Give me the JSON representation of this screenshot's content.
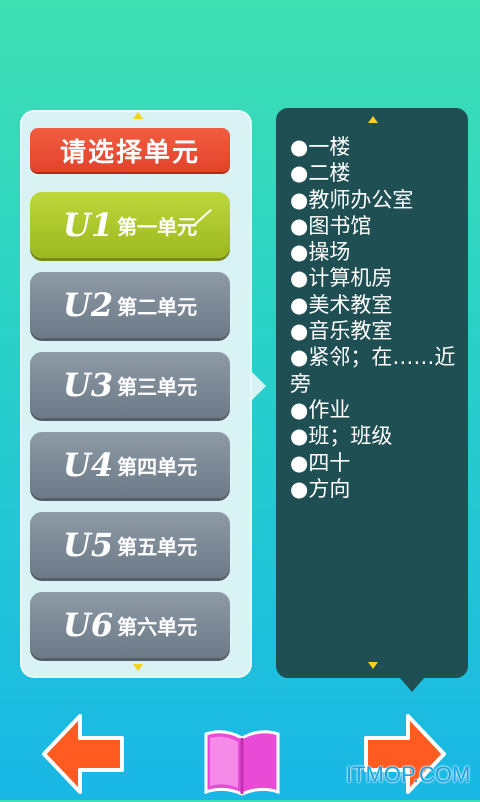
{
  "left_panel": {
    "header_label": "请选择单元",
    "units": [
      {
        "code": "U1",
        "name": "第一单元",
        "active": true
      },
      {
        "code": "U2",
        "name": "第二单元",
        "active": false
      },
      {
        "code": "U3",
        "name": "第三单元",
        "active": false
      },
      {
        "code": "U4",
        "name": "第四单元",
        "active": false
      },
      {
        "code": "U5",
        "name": "第五单元",
        "active": false
      },
      {
        "code": "U6",
        "name": "第六单元",
        "active": false
      }
    ]
  },
  "vocab": {
    "bullet": "●",
    "items": [
      "一楼",
      "二楼",
      "教师办公室",
      "图书馆",
      "操场",
      "计算机房",
      "美术教室",
      "音乐教室",
      "紧邻；在……近旁",
      "作业",
      "班；班级",
      "四十",
      "方向"
    ]
  },
  "bottom_nav": {
    "prev_icon": "left-arrow-icon",
    "book_icon": "book-icon",
    "next_icon": "right-arrow-icon"
  },
  "watermark": "ITMOP.COM",
  "colors": {
    "header_red": "#e2432a",
    "active_green": "#a9c52a",
    "unit_gray": "#7a8794",
    "vocab_bg": "#1f4f52",
    "indicator_yellow": "#f6d21d",
    "arrow_red": "#ff5a1f",
    "book_pink": "#e94bd6"
  }
}
